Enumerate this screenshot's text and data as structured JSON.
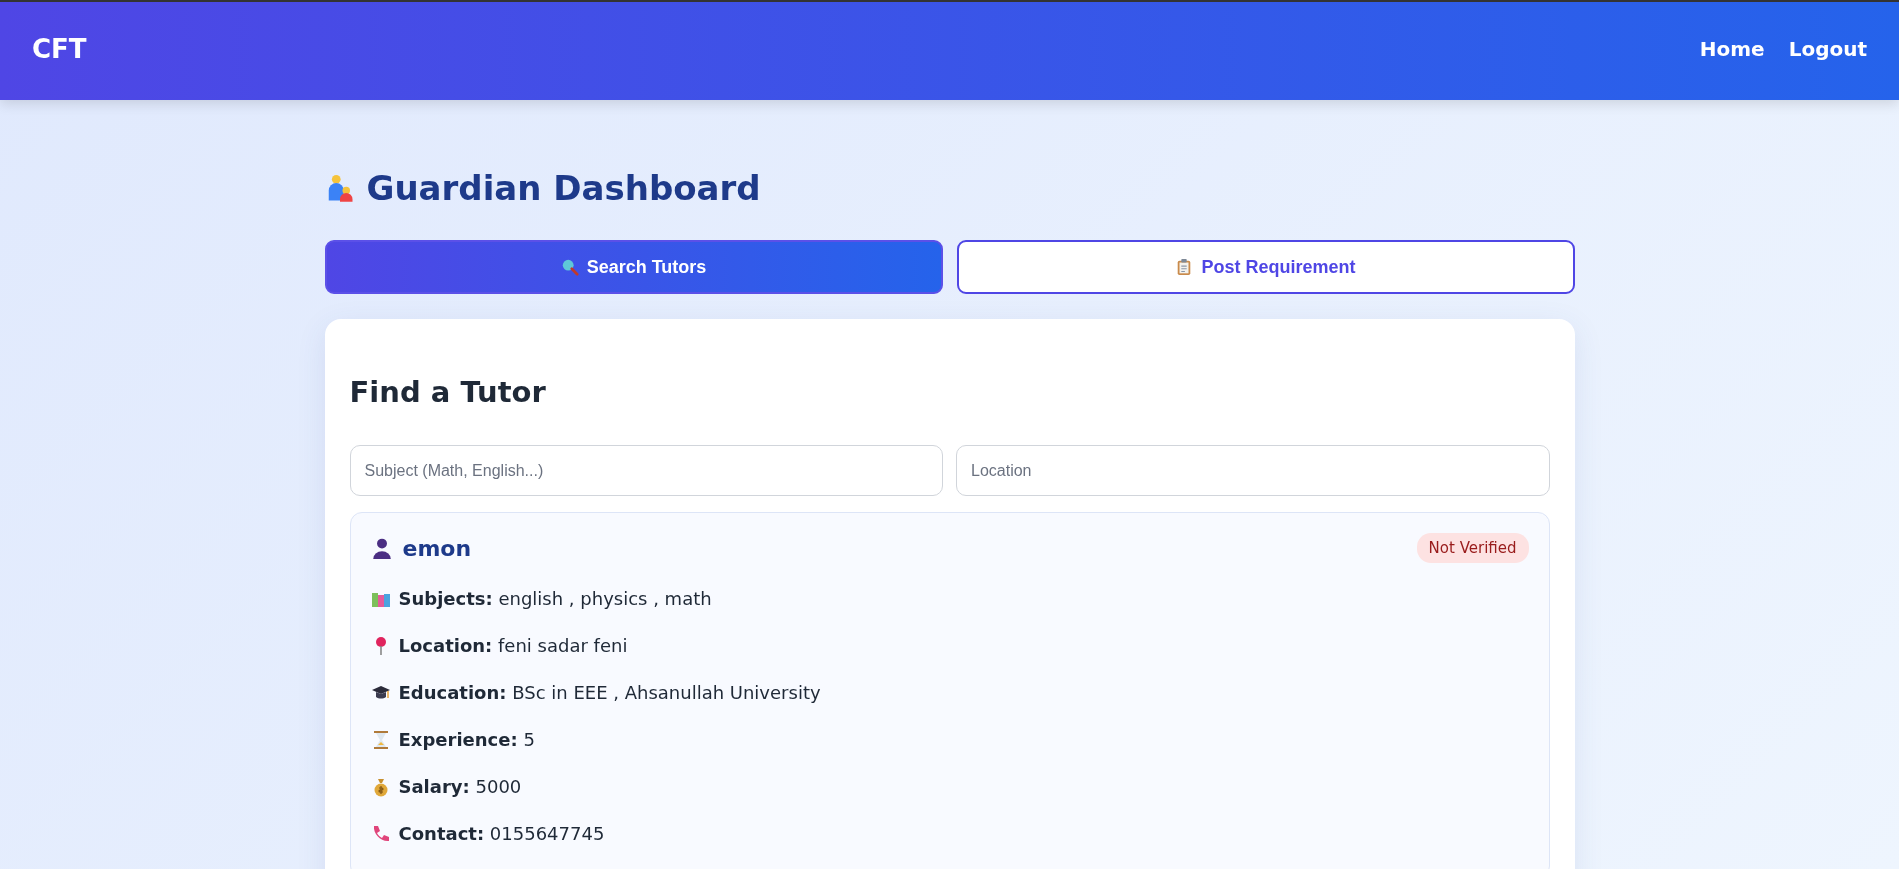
{
  "navbar": {
    "logo": "CFT",
    "links": [
      "Home",
      "Logout"
    ]
  },
  "page_title": "Guardian Dashboard",
  "tabs": [
    {
      "label": "Search Tutors",
      "kind": "search",
      "selected": true
    },
    {
      "label": "Post Requirement",
      "kind": "clipboard",
      "selected": false
    }
  ],
  "search_panel": {
    "title": "Find a Tutor",
    "fields": [
      {
        "placeholder": "Subject (Math, English...)"
      },
      {
        "placeholder": "Location"
      }
    ]
  },
  "tutors": [
    {
      "name": "emon",
      "badge": "Not Verified",
      "details": [
        {
          "kind": "subjects",
          "text": "**Subjects:** english , physics , math"
        },
        {
          "kind": "location",
          "text": "**Location:** feni sadar feni"
        },
        {
          "kind": "education",
          "text": "**Education:** BSc in EEE , Ahsanullah University"
        },
        {
          "kind": "experience",
          "text": "**Experience:** 5"
        },
        {
          "kind": "salary",
          "text": "**Salary:** 5000"
        },
        {
          "kind": "contact",
          "text": "**Contact:** 0155647745"
        }
      ]
    }
  ]
}
